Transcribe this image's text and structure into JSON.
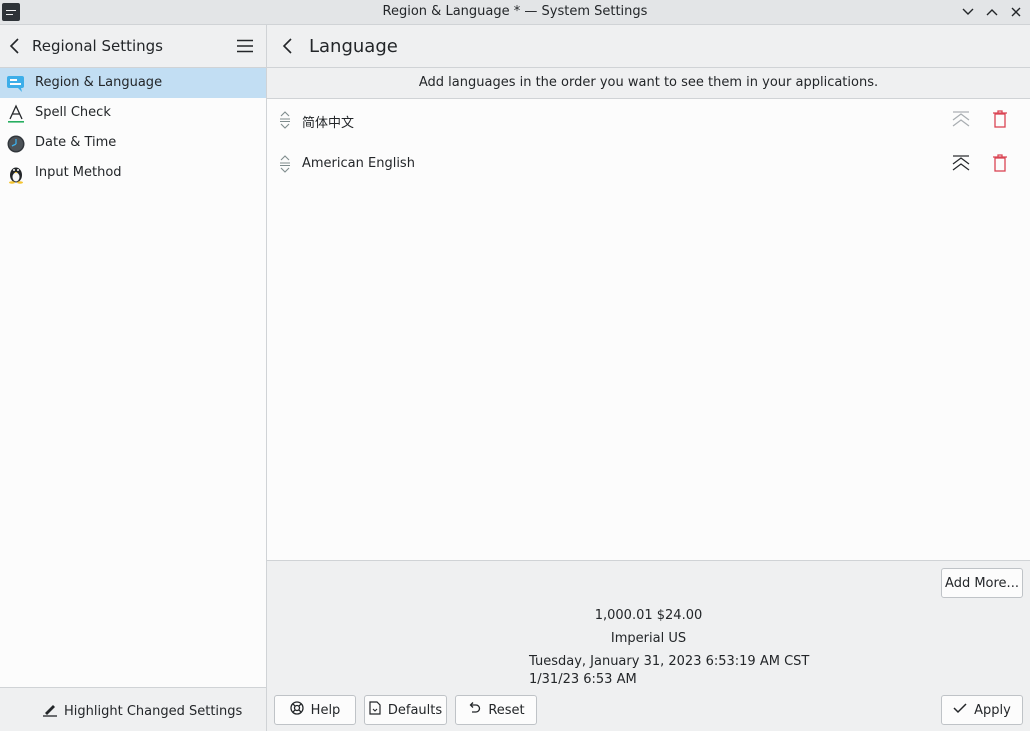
{
  "window": {
    "title": "Region & Language * — System Settings",
    "icon": "system-settings-icon",
    "controls": [
      "minimize-icon",
      "maximize-icon",
      "close-icon"
    ]
  },
  "sidebar": {
    "header": "Regional Settings",
    "items": [
      {
        "label": "Region & Language",
        "icon": "region-language-icon",
        "selected": true
      },
      {
        "label": "Spell Check",
        "icon": "spell-check-icon",
        "selected": false
      },
      {
        "label": "Date & Time",
        "icon": "clock-icon",
        "selected": false
      },
      {
        "label": "Input Method",
        "icon": "penguin-icon",
        "selected": false
      }
    ],
    "footer_button": "Highlight Changed Settings"
  },
  "main": {
    "title": "Language",
    "info": "Add languages in the order you want to see them in your applications.",
    "languages": [
      {
        "name": "简体中文"
      },
      {
        "name": "American English"
      }
    ],
    "add_more": "Add More...",
    "preview": {
      "numbers": "1,000.01  $24.00",
      "measurement": "Imperial US",
      "long_date": "Tuesday, January 31, 2023 6:53:19 AM CST",
      "short_date": "1/31/23 6:53 AM"
    },
    "buttons": {
      "help": "Help",
      "defaults": "Defaults",
      "reset": "Reset",
      "apply": "Apply"
    }
  },
  "colors": {
    "selection": "#c2def3",
    "delete_red": "#da4453",
    "accent_blue": "#3daee9"
  }
}
